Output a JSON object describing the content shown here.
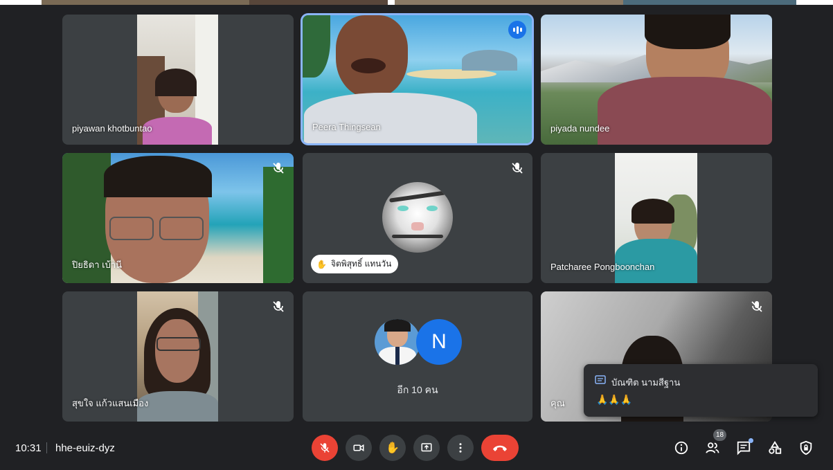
{
  "meeting": {
    "time": "10:31",
    "code": "hhe-euiz-dyz",
    "participant_count": "18"
  },
  "tiles": [
    {
      "name": "piyawan khotbuntao"
    },
    {
      "name": "Peera Thingsean",
      "speaking": true
    },
    {
      "name": "piyada nundee"
    },
    {
      "name": "ปิยธิดา เบ้านี",
      "muted": true
    },
    {
      "name": "จิตพิสุทธิ์ แทนวัน",
      "muted": true,
      "hand_raised": true,
      "avatar": "tiger-avatar"
    },
    {
      "name": "Patcharee Pongboonchan"
    },
    {
      "name": "สุขใจ แก้วแสนเมือง",
      "muted": true
    },
    {
      "more_label": "อีก 10 คน",
      "avatar_letter": "N"
    },
    {
      "name": "คุณ",
      "muted": true
    }
  ],
  "chat_toast": {
    "sender": "บัณฑิต นามสีฐาน",
    "message": "🙏🙏🙏"
  },
  "controls": [
    "mic-off-icon",
    "camera-icon",
    "raise-hand-icon",
    "present-icon",
    "more-options-icon",
    "end-call-icon"
  ],
  "right_controls": [
    "info-icon",
    "people-icon",
    "chat-icon",
    "activities-icon",
    "host-controls-icon"
  ],
  "colors": {
    "background": "#202124",
    "tile": "#3c4043",
    "accent_blue": "#8ab4f8",
    "red": "#ea4335"
  }
}
